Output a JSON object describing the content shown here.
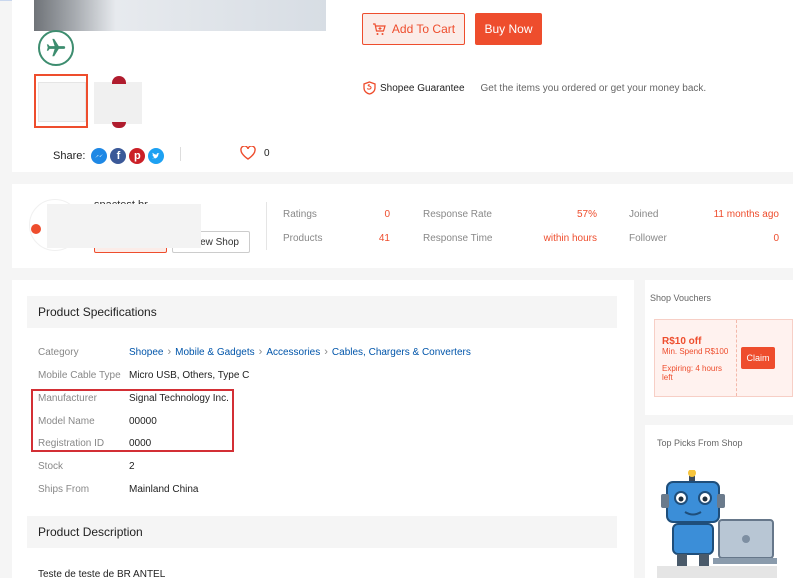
{
  "product": {
    "add_to_cart_label": "Add To Cart",
    "buy_now_label": "Buy Now",
    "guarantee_title": "Shopee Guarantee",
    "guarantee_desc": "Get the items you ordered or get your money back.",
    "share_label": "Share:",
    "likes_count": "0"
  },
  "shop": {
    "name": "spactest.br",
    "view_shop_label": "View Shop",
    "stats": [
      {
        "label": "Ratings",
        "value": "0"
      },
      {
        "label": "Products",
        "value": "41"
      },
      {
        "label": "Response Rate",
        "value": "57%"
      },
      {
        "label": "Response Time",
        "value": "within hours"
      },
      {
        "label": "Joined",
        "value": "11 months ago"
      },
      {
        "label": "Follower",
        "value": "0"
      }
    ]
  },
  "specs": {
    "title": "Product Specifications",
    "category_label": "Category",
    "category_path": [
      "Shopee",
      "Mobile & Gadgets",
      "Accessories",
      "Cables, Chargers & Converters"
    ],
    "rows": [
      {
        "label": "Mobile Cable Type",
        "value": "Micro USB, Others, Type C"
      },
      {
        "label": "Manufacturer",
        "value": "Signal Technology Inc."
      },
      {
        "label": "Model Name",
        "value": "00000"
      },
      {
        "label": "Registration ID",
        "value": "0000"
      },
      {
        "label": "Stock",
        "value": "2"
      },
      {
        "label": "Ships From",
        "value": "Mainland China"
      }
    ]
  },
  "description": {
    "title": "Product Description",
    "text": "Teste de teste de BR ANTEL"
  },
  "sidebar": {
    "vouchers_title": "Shop Vouchers",
    "voucher": {
      "amount": "R$10 off",
      "min_spend": "Min. Spend R$100",
      "expiry": "Expiring: 4 hours left",
      "claim_label": "Claim"
    },
    "top_picks_title": "Top Picks From Shop"
  },
  "colors": {
    "accent": "#ee4d2d",
    "link": "#0055aa",
    "highlight": "#d32f35"
  }
}
